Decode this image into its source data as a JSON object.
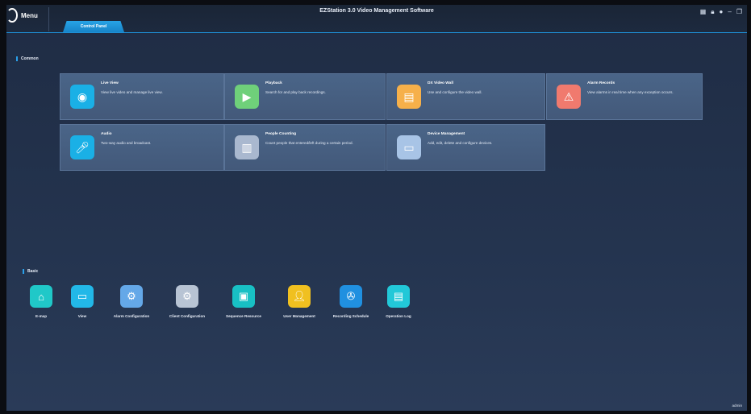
{
  "titlebar": {
    "menu_label": "Menu",
    "app_title": "EZStation 3.0 Video Management Software",
    "active_tab": "Control Panel",
    "icons": [
      "grid-icon",
      "lock-icon",
      "info-icon",
      "minimize-icon",
      "restore-icon"
    ]
  },
  "common": {
    "heading": "Common",
    "cards": [
      {
        "title": "Live View",
        "desc": "View live video and manage live view.",
        "icon": "camera-icon",
        "color": "#1ab0e6"
      },
      {
        "title": "Playback",
        "desc": "Search for and play back recordings.",
        "icon": "playback-icon",
        "color": "#6fd07a"
      },
      {
        "title": "DX Video Wall",
        "desc": "Use and configure the video wall.",
        "icon": "video-wall-icon",
        "color": "#f6b04a"
      },
      {
        "title": "Alarm Records",
        "desc": "View alarms in real time when any exception occurs.",
        "icon": "alarm-icon",
        "color": "#f07a6e"
      },
      {
        "title": "Audio",
        "desc": "Two-way audio and broadcast.",
        "icon": "microphone-icon",
        "color": "#1ab0e6"
      },
      {
        "title": "People Counting",
        "desc": "Count people that entered/left during a certain period.",
        "icon": "people-counting-icon",
        "color": "#a9b8cf"
      },
      {
        "title": "Device Management",
        "desc": "Add, edit, delete and configure devices.",
        "icon": "device-icon",
        "color": "#a8c4e6"
      }
    ]
  },
  "basic": {
    "heading": "Basic",
    "items": [
      {
        "label": "E-map",
        "icon": "emap-icon",
        "color": "#20c8c8"
      },
      {
        "label": "View",
        "icon": "view-icon",
        "color": "#22b8e8"
      },
      {
        "label": "Alarm Configuration",
        "icon": "alarm-config-icon",
        "color": "#64a8e8"
      },
      {
        "label": "Client Configuration",
        "icon": "client-config-icon",
        "color": "#b8c4d4"
      },
      {
        "label": "Sequence Resource",
        "icon": "sequence-icon",
        "color": "#18c0c4"
      },
      {
        "label": "User Management",
        "icon": "user-icon",
        "color": "#f0c020"
      },
      {
        "label": "Recording Schedule",
        "icon": "recording-icon",
        "color": "#2090e0"
      },
      {
        "label": "Operation Log",
        "icon": "log-icon",
        "color": "#22c8d8"
      }
    ]
  },
  "status": {
    "user": "admin"
  }
}
